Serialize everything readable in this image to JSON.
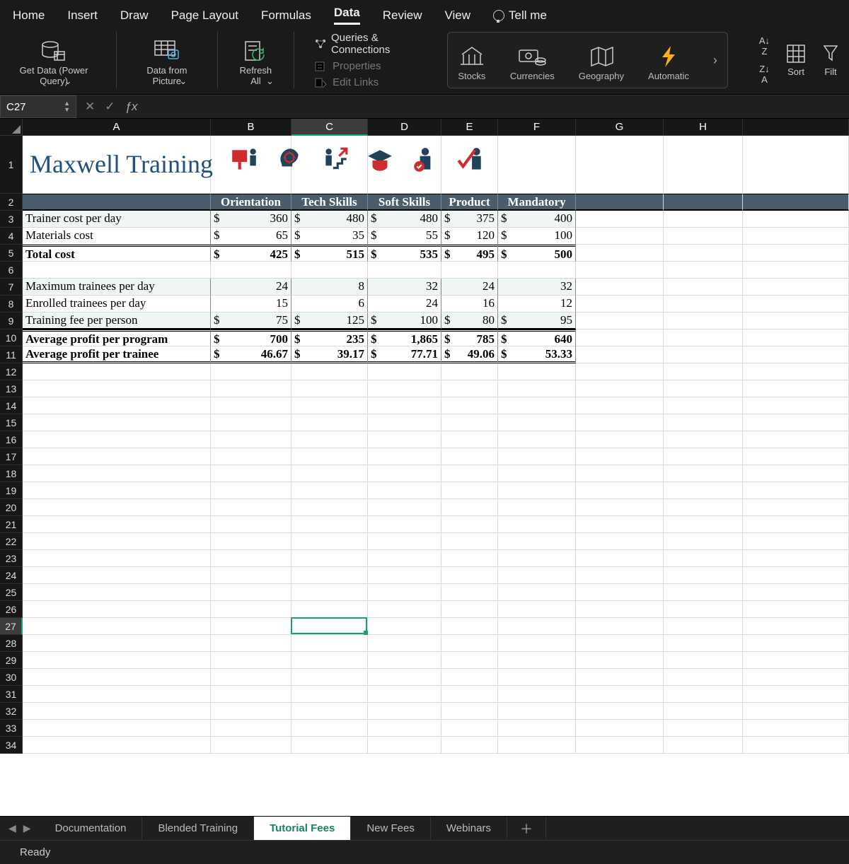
{
  "ribbonTabs": {
    "home": "Home",
    "insert": "Insert",
    "draw": "Draw",
    "layout": "Page Layout",
    "formulas": "Formulas",
    "data": "Data",
    "review": "Review",
    "view": "View",
    "tellme": "Tell me"
  },
  "ribbon": {
    "getData": "Get Data (Power Query)",
    "fromPic": "Data from Picture",
    "refresh": "Refresh All",
    "qc": "Queries & Connections",
    "props": "Properties",
    "links": "Edit Links",
    "stocks": "Stocks",
    "curr": "Currencies",
    "geo": "Geography",
    "auto": "Automatic",
    "sortaz": "A→Z",
    "sortza": "Z→A",
    "sort": "Sort",
    "filter": "Filter"
  },
  "nameBox": "C27",
  "formula": "",
  "cols": [
    "A",
    "B",
    "C",
    "D",
    "E",
    "F",
    "G",
    "H"
  ],
  "title": "Maxwell Training",
  "iconNames": [
    "presentation",
    "idea-head",
    "growth-stairs",
    "graduation",
    "award-person",
    "approve-person"
  ],
  "table": {
    "headers": [
      "",
      "Orientation",
      "Tech Skills",
      "Soft Skills",
      "Product",
      "Mandatory"
    ],
    "rows": [
      {
        "label": "Trainer cost per day",
        "vals": [
          "360",
          "480",
          "480",
          "375",
          "400"
        ],
        "money": true,
        "shade": true
      },
      {
        "label": "Materials cost",
        "vals": [
          "65",
          "35",
          "55",
          "120",
          "100"
        ],
        "money": true
      },
      {
        "label": "Total cost",
        "vals": [
          "425",
          "515",
          "535",
          "495",
          "500"
        ],
        "money": true,
        "bold": true,
        "dtop": true
      },
      {
        "blank": true
      },
      {
        "label": "Maximum trainees per day",
        "vals": [
          "24",
          "8",
          "32",
          "24",
          "32"
        ],
        "shade": true
      },
      {
        "label": "Enrolled trainees per day",
        "vals": [
          "15",
          "6",
          "24",
          "16",
          "12"
        ]
      },
      {
        "label": "Training fee per person",
        "vals": [
          "75",
          "125",
          "100",
          "80",
          "95"
        ],
        "money": true,
        "shade": true,
        "botline": true
      },
      {
        "label": "Average profit per program",
        "vals": [
          "700",
          "235",
          "1,865",
          "785",
          "640"
        ],
        "money": true,
        "bold": true,
        "dtop": true
      },
      {
        "label": "Average profit per trainee",
        "vals": [
          "46.67",
          "39.17",
          "77.71",
          "49.06",
          "53.33"
        ],
        "money": true,
        "bold": true,
        "botline2": true,
        "tightE": true
      }
    ]
  },
  "sheetTabs": [
    "Documentation",
    "Blended Training",
    "Tutorial Fees",
    "New Fees",
    "Webinars"
  ],
  "activeSheet": "Tutorial Fees",
  "status": "Ready"
}
